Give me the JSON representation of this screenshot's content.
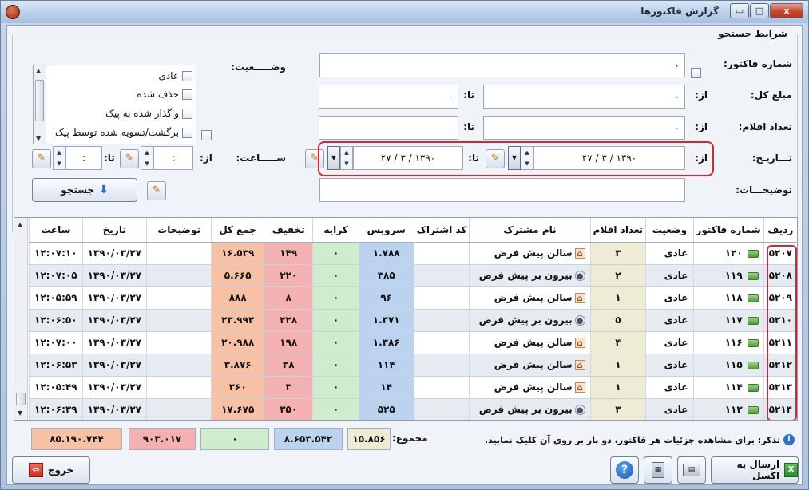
{
  "window": {
    "title": "گزارش فاکتورها",
    "min_label": "▭",
    "max_label": "□",
    "close_label": "x"
  },
  "search": {
    "group_title": "شرایط جستجو",
    "invoice_no_label": "شماره فاکتور:",
    "invoice_no_value": "۰",
    "amount_label": "مبلغ کل:",
    "amount_from_label": "از:",
    "amount_from_value": "۰",
    "amount_to_label": "تا:",
    "amount_to_value": "۰",
    "items_label": "تعداد اقلام:",
    "items_from_label": "از:",
    "items_from_value": "۰",
    "items_to_label": "تا:",
    "items_to_value": "۰",
    "date_label": "تـــاریـخ:",
    "date_from_label": "از:",
    "date_from_value": "۲۷ / ۳ / ۱۳۹۰",
    "date_to_label": "تا:",
    "date_to_value": "۲۷ / ۳ / ۱۳۹۰",
    "desc_label": "توضیحـــات:",
    "desc_value": "",
    "status_label": "وضـــــعیت:",
    "status_options": [
      "عادی",
      "حذف شده",
      "واگذار شده به پیک",
      "برگشت/تسویه شده توسط پیک"
    ],
    "time_label": "ســـــاعت:",
    "time_from_label": "از:",
    "time_from_value": ":",
    "time_to_label": "تا:",
    "time_to_value": ":",
    "search_button": "جستجو"
  },
  "table": {
    "columns": [
      "ردیف",
      "شماره فاکتور",
      "وضعیت",
      "تعداد اقلام",
      "نام مشترک",
      "کد اشتراک",
      "سرویس",
      "کرایه",
      "تخفیف",
      "جمع کل",
      "توضیحات",
      "تاریخ",
      "ساعت"
    ],
    "rows": [
      {
        "radif": "۵۲۰۷",
        "num": "۱۲۰",
        "status": "عادی",
        "qty": "۳",
        "cust": "سالن پیش فرض",
        "cust_icon": "home-icon",
        "code": "",
        "service": "۱.۷۸۸",
        "fare": "۰",
        "disc": "۱۴۹",
        "total": "۱۶.۵۳۹",
        "desc": "",
        "date": "۱۳۹۰/۰۳/۲۷",
        "time": "۱۲:۰۷:۱۰"
      },
      {
        "radif": "۵۲۰۸",
        "num": "۱۱۹",
        "status": "عادی",
        "qty": "۲",
        "cust": "بیرون بر پیش فرض",
        "cust_icon": "person-icon",
        "code": "",
        "service": "۳۸۵",
        "fare": "۰",
        "disc": "۲۲۰",
        "total": "۵.۶۶۵",
        "desc": "",
        "date": "۱۳۹۰/۰۳/۲۷",
        "time": "۱۲:۰۷:۰۵"
      },
      {
        "radif": "۵۲۰۹",
        "num": "۱۱۸",
        "status": "عادی",
        "qty": "۱",
        "cust": "سالن پیش فرض",
        "cust_icon": "home-icon",
        "code": "",
        "service": "۹۶",
        "fare": "۰",
        "disc": "۸",
        "total": "۸۸۸",
        "desc": "",
        "date": "۱۳۹۰/۰۳/۲۷",
        "time": "۱۲:۰۵:۵۹"
      },
      {
        "radif": "۵۲۱۰",
        "num": "۱۱۷",
        "status": "عادی",
        "qty": "۵",
        "cust": "بیرون بر پیش فرض",
        "cust_icon": "person-icon",
        "code": "",
        "service": "۱.۳۷۱",
        "fare": "۰",
        "disc": "۲۲۸",
        "total": "۲۳.۹۹۲",
        "desc": "",
        "date": "۱۳۹۰/۰۳/۲۷",
        "time": "۱۲:۰۶:۵۰"
      },
      {
        "radif": "۵۲۱۱",
        "num": "۱۱۶",
        "status": "عادی",
        "qty": "۴",
        "cust": "سالن پیش فرض",
        "cust_icon": "home-icon",
        "code": "",
        "service": "۱.۳۸۶",
        "fare": "۰",
        "disc": "۱۹۸",
        "total": "۲۰.۹۸۸",
        "desc": "",
        "date": "۱۳۹۰/۰۳/۲۷",
        "time": "۱۲:۰۷:۰۰"
      },
      {
        "radif": "۵۲۱۲",
        "num": "۱۱۵",
        "status": "عادی",
        "qty": "۱",
        "cust": "سالن پیش فرض",
        "cust_icon": "home-icon",
        "code": "",
        "service": "۱۱۴",
        "fare": "۰",
        "disc": "۳۸",
        "total": "۳.۸۷۶",
        "desc": "",
        "date": "۱۳۹۰/۰۳/۲۷",
        "time": "۱۲:۰۶:۵۳"
      },
      {
        "radif": "۵۲۱۳",
        "num": "۱۱۴",
        "status": "عادی",
        "qty": "۱",
        "cust": "سالن پیش فرض",
        "cust_icon": "home-icon",
        "code": "",
        "service": "۱۴",
        "fare": "۰",
        "disc": "۳",
        "total": "۳۶۰",
        "desc": "",
        "date": "۱۳۹۰/۰۳/۲۷",
        "time": "۱۲:۰۵:۴۹"
      },
      {
        "radif": "۵۲۱۴",
        "num": "۱۱۳",
        "status": "عادی",
        "qty": "۳",
        "cust": "بیرون بر پیش فرض",
        "cust_icon": "person-icon",
        "code": "",
        "service": "۵۲۵",
        "fare": "۰",
        "disc": "۳۵۰",
        "total": "۱۷.۶۷۵",
        "desc": "",
        "date": "۱۳۹۰/۰۳/۲۷",
        "time": "۱۲:۰۶:۳۹"
      }
    ]
  },
  "summary": {
    "label": "مجموع:",
    "qty_total": "۱۵.۸۵۶",
    "service_total": "۸.۶۵۳.۵۴۲",
    "fare_total": "۰",
    "disc_total": "۹۰۳.۰۱۷",
    "grand_total": "۸۵.۱۹۰.۷۴۴",
    "note": "تذکر: برای مشاهده جزئیات هر فاکتور، دو بار بر روی آن کلیک نمایید."
  },
  "footer": {
    "excel_button": "ارسال به اکسل",
    "exit_button": "خروج",
    "help_glyph": "?",
    "calc_glyph": "▦",
    "print_glyph": "▤",
    "excel_glyph": "X",
    "exit_glyph": "⇦"
  },
  "colors": {
    "service": "#bcd3ef",
    "fare": "#cfeccf",
    "discount": "#f4b1b1",
    "total": "#f7c1a6",
    "qty": "#eeecd5",
    "highlight": "#d6262f"
  }
}
